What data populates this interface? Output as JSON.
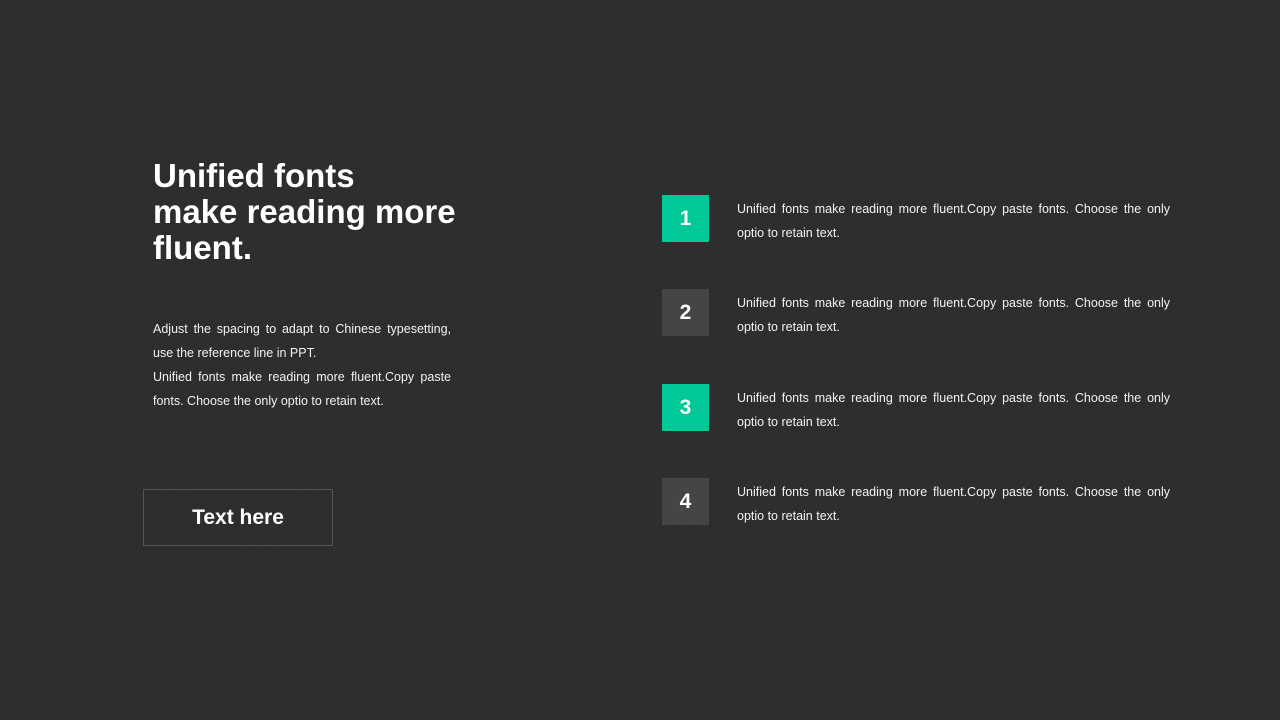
{
  "heading": {
    "line1": "Unified fonts",
    "line2": "make reading more",
    "line3": "fluent."
  },
  "description": {
    "paragraph1": "Adjust the spacing to adapt to Chinese typesetting, use the reference line in PPT.",
    "paragraph2": "Unified fonts make reading more fluent.Copy paste fonts. Choose the only optio to retain text."
  },
  "button": {
    "label": "Text here"
  },
  "colors": {
    "background": "#2d2d2d",
    "accent": "#00c896",
    "badge_dark": "#454545"
  },
  "items": [
    {
      "number": "1",
      "style": "accent",
      "text": "Unified fonts make reading more fluent.Copy paste fonts. Choose the only optio to retain text."
    },
    {
      "number": "2",
      "style": "dark",
      "text": "Unified fonts make reading more fluent.Copy paste fonts. Choose the only optio to retain text."
    },
    {
      "number": "3",
      "style": "accent",
      "text": "Unified fonts make reading more fluent.Copy paste fonts. Choose the only optio to retain text."
    },
    {
      "number": "4",
      "style": "dark",
      "text": "Unified fonts make reading more fluent.Copy paste fonts. Choose the only optio to retain text."
    }
  ]
}
